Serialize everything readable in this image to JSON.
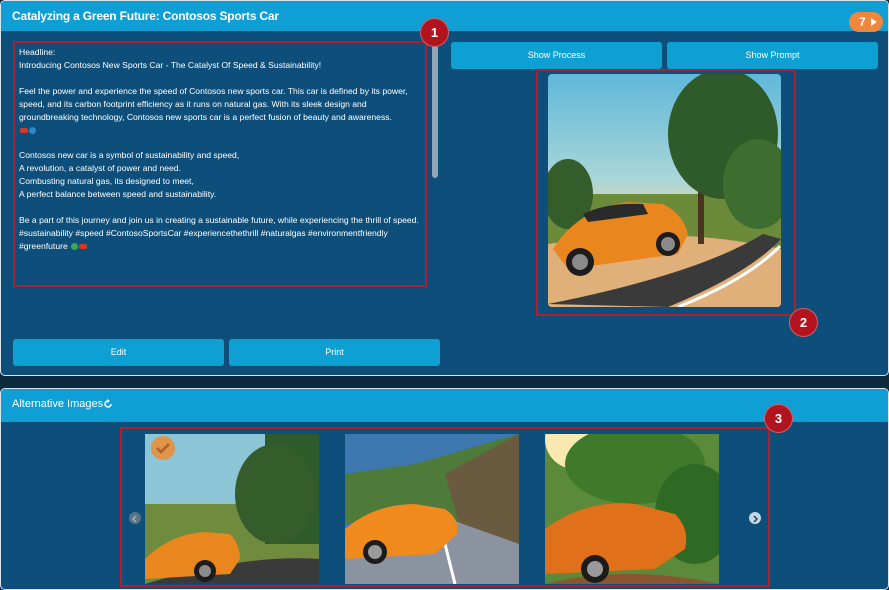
{
  "main_panel": {
    "title": "Catalyzing a Green Future: Contosos Sports Car",
    "badge_count": "7"
  },
  "post": {
    "line1": "Headline:",
    "line2": "Introducing Contosos New Sports Car - The Catalyst Of Speed & Sustainability!",
    "para1": "Feel the power and experience the speed of Contosos new sports car. This car is defined by its power, speed, and its carbon footprint efficiency as it runs on natural gas. With its sleek design and groundbreaking technology, Contosos new sports car is a perfect fusion of beauty and awareness.",
    "poem1": "Contosos new car is a symbol of sustainability and speed,",
    "poem2": "A revolution, a catalyst of power and need.",
    "poem3": "Combusting natural gas, its designed to meet,",
    "poem4": "A perfect balance between speed and sustainability.",
    "para3": "Be a part of this journey and join us in creating a sustainable future, while experiencing the thrill of speed.  #sustainability #speed #ContosoSportsCar #experiencethethrill #naturalgas #environmentfriendly #greenfuture"
  },
  "buttons": {
    "show_process": "Show Process",
    "show_prompt": "Show Prompt",
    "edit": "Edit",
    "print": "Print"
  },
  "markers": [
    "1",
    "2",
    "3"
  ],
  "alternatives": {
    "title": "Alternative Images"
  },
  "colors": {
    "header": "#0f9fd4",
    "panel": "#0d4f7a",
    "button": "#0e9fd3",
    "badge": "#f0853c",
    "highlight": "#b0202c"
  },
  "icons": [
    "play-icon",
    "refresh-icon",
    "check-icon",
    "chevron-left-icon",
    "chevron-right-icon"
  ]
}
